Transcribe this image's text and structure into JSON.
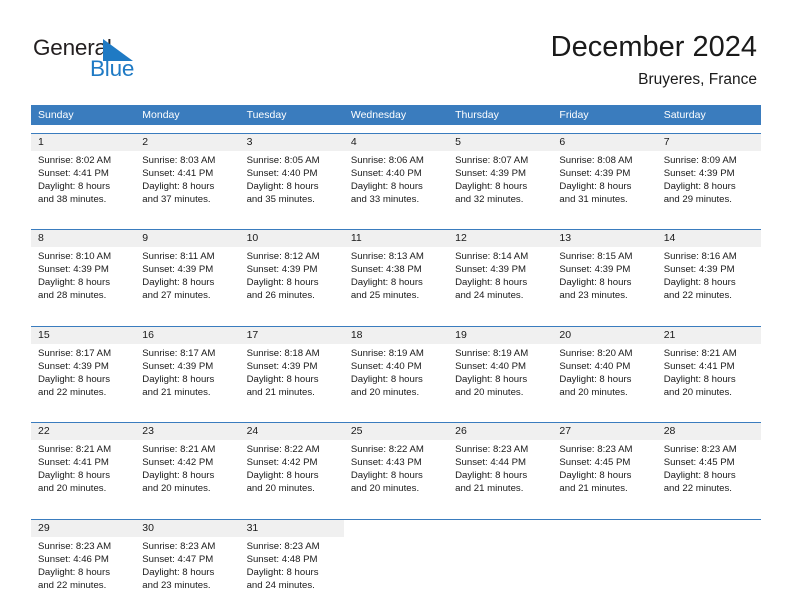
{
  "brand": {
    "name_part1": "General",
    "name_part2": "Blue",
    "triangle_icon": "blue-triangle-icon",
    "color_dark": "#231f20",
    "color_blue": "#1f7ac4"
  },
  "header": {
    "title": "December 2024",
    "subtitle": "Bruyeres, France"
  },
  "calendar": {
    "header_bg": "#3a7cbe",
    "daynum_bg": "#f0f0f0",
    "weekdays": [
      "Sunday",
      "Monday",
      "Tuesday",
      "Wednesday",
      "Thursday",
      "Friday",
      "Saturday"
    ],
    "weeks": [
      [
        {
          "day": "1",
          "sunrise": "Sunrise: 8:02 AM",
          "sunset": "Sunset: 4:41 PM",
          "daylight1": "Daylight: 8 hours",
          "daylight2": "and 38 minutes."
        },
        {
          "day": "2",
          "sunrise": "Sunrise: 8:03 AM",
          "sunset": "Sunset: 4:41 PM",
          "daylight1": "Daylight: 8 hours",
          "daylight2": "and 37 minutes."
        },
        {
          "day": "3",
          "sunrise": "Sunrise: 8:05 AM",
          "sunset": "Sunset: 4:40 PM",
          "daylight1": "Daylight: 8 hours",
          "daylight2": "and 35 minutes."
        },
        {
          "day": "4",
          "sunrise": "Sunrise: 8:06 AM",
          "sunset": "Sunset: 4:40 PM",
          "daylight1": "Daylight: 8 hours",
          "daylight2": "and 33 minutes."
        },
        {
          "day": "5",
          "sunrise": "Sunrise: 8:07 AM",
          "sunset": "Sunset: 4:39 PM",
          "daylight1": "Daylight: 8 hours",
          "daylight2": "and 32 minutes."
        },
        {
          "day": "6",
          "sunrise": "Sunrise: 8:08 AM",
          "sunset": "Sunset: 4:39 PM",
          "daylight1": "Daylight: 8 hours",
          "daylight2": "and 31 minutes."
        },
        {
          "day": "7",
          "sunrise": "Sunrise: 8:09 AM",
          "sunset": "Sunset: 4:39 PM",
          "daylight1": "Daylight: 8 hours",
          "daylight2": "and 29 minutes."
        }
      ],
      [
        {
          "day": "8",
          "sunrise": "Sunrise: 8:10 AM",
          "sunset": "Sunset: 4:39 PM",
          "daylight1": "Daylight: 8 hours",
          "daylight2": "and 28 minutes."
        },
        {
          "day": "9",
          "sunrise": "Sunrise: 8:11 AM",
          "sunset": "Sunset: 4:39 PM",
          "daylight1": "Daylight: 8 hours",
          "daylight2": "and 27 minutes."
        },
        {
          "day": "10",
          "sunrise": "Sunrise: 8:12 AM",
          "sunset": "Sunset: 4:39 PM",
          "daylight1": "Daylight: 8 hours",
          "daylight2": "and 26 minutes."
        },
        {
          "day": "11",
          "sunrise": "Sunrise: 8:13 AM",
          "sunset": "Sunset: 4:38 PM",
          "daylight1": "Daylight: 8 hours",
          "daylight2": "and 25 minutes."
        },
        {
          "day": "12",
          "sunrise": "Sunrise: 8:14 AM",
          "sunset": "Sunset: 4:39 PM",
          "daylight1": "Daylight: 8 hours",
          "daylight2": "and 24 minutes."
        },
        {
          "day": "13",
          "sunrise": "Sunrise: 8:15 AM",
          "sunset": "Sunset: 4:39 PM",
          "daylight1": "Daylight: 8 hours",
          "daylight2": "and 23 minutes."
        },
        {
          "day": "14",
          "sunrise": "Sunrise: 8:16 AM",
          "sunset": "Sunset: 4:39 PM",
          "daylight1": "Daylight: 8 hours",
          "daylight2": "and 22 minutes."
        }
      ],
      [
        {
          "day": "15",
          "sunrise": "Sunrise: 8:17 AM",
          "sunset": "Sunset: 4:39 PM",
          "daylight1": "Daylight: 8 hours",
          "daylight2": "and 22 minutes."
        },
        {
          "day": "16",
          "sunrise": "Sunrise: 8:17 AM",
          "sunset": "Sunset: 4:39 PM",
          "daylight1": "Daylight: 8 hours",
          "daylight2": "and 21 minutes."
        },
        {
          "day": "17",
          "sunrise": "Sunrise: 8:18 AM",
          "sunset": "Sunset: 4:39 PM",
          "daylight1": "Daylight: 8 hours",
          "daylight2": "and 21 minutes."
        },
        {
          "day": "18",
          "sunrise": "Sunrise: 8:19 AM",
          "sunset": "Sunset: 4:40 PM",
          "daylight1": "Daylight: 8 hours",
          "daylight2": "and 20 minutes."
        },
        {
          "day": "19",
          "sunrise": "Sunrise: 8:19 AM",
          "sunset": "Sunset: 4:40 PM",
          "daylight1": "Daylight: 8 hours",
          "daylight2": "and 20 minutes."
        },
        {
          "day": "20",
          "sunrise": "Sunrise: 8:20 AM",
          "sunset": "Sunset: 4:40 PM",
          "daylight1": "Daylight: 8 hours",
          "daylight2": "and 20 minutes."
        },
        {
          "day": "21",
          "sunrise": "Sunrise: 8:21 AM",
          "sunset": "Sunset: 4:41 PM",
          "daylight1": "Daylight: 8 hours",
          "daylight2": "and 20 minutes."
        }
      ],
      [
        {
          "day": "22",
          "sunrise": "Sunrise: 8:21 AM",
          "sunset": "Sunset: 4:41 PM",
          "daylight1": "Daylight: 8 hours",
          "daylight2": "and 20 minutes."
        },
        {
          "day": "23",
          "sunrise": "Sunrise: 8:21 AM",
          "sunset": "Sunset: 4:42 PM",
          "daylight1": "Daylight: 8 hours",
          "daylight2": "and 20 minutes."
        },
        {
          "day": "24",
          "sunrise": "Sunrise: 8:22 AM",
          "sunset": "Sunset: 4:42 PM",
          "daylight1": "Daylight: 8 hours",
          "daylight2": "and 20 minutes."
        },
        {
          "day": "25",
          "sunrise": "Sunrise: 8:22 AM",
          "sunset": "Sunset: 4:43 PM",
          "daylight1": "Daylight: 8 hours",
          "daylight2": "and 20 minutes."
        },
        {
          "day": "26",
          "sunrise": "Sunrise: 8:23 AM",
          "sunset": "Sunset: 4:44 PM",
          "daylight1": "Daylight: 8 hours",
          "daylight2": "and 21 minutes."
        },
        {
          "day": "27",
          "sunrise": "Sunrise: 8:23 AM",
          "sunset": "Sunset: 4:45 PM",
          "daylight1": "Daylight: 8 hours",
          "daylight2": "and 21 minutes."
        },
        {
          "day": "28",
          "sunrise": "Sunrise: 8:23 AM",
          "sunset": "Sunset: 4:45 PM",
          "daylight1": "Daylight: 8 hours",
          "daylight2": "and 22 minutes."
        }
      ],
      [
        {
          "day": "29",
          "sunrise": "Sunrise: 8:23 AM",
          "sunset": "Sunset: 4:46 PM",
          "daylight1": "Daylight: 8 hours",
          "daylight2": "and 22 minutes."
        },
        {
          "day": "30",
          "sunrise": "Sunrise: 8:23 AM",
          "sunset": "Sunset: 4:47 PM",
          "daylight1": "Daylight: 8 hours",
          "daylight2": "and 23 minutes."
        },
        {
          "day": "31",
          "sunrise": "Sunrise: 8:23 AM",
          "sunset": "Sunset: 4:48 PM",
          "daylight1": "Daylight: 8 hours",
          "daylight2": "and 24 minutes."
        },
        {
          "day": "",
          "sunrise": "",
          "sunset": "",
          "daylight1": "",
          "daylight2": ""
        },
        {
          "day": "",
          "sunrise": "",
          "sunset": "",
          "daylight1": "",
          "daylight2": ""
        },
        {
          "day": "",
          "sunrise": "",
          "sunset": "",
          "daylight1": "",
          "daylight2": ""
        },
        {
          "day": "",
          "sunrise": "",
          "sunset": "",
          "daylight1": "",
          "daylight2": ""
        }
      ]
    ]
  }
}
